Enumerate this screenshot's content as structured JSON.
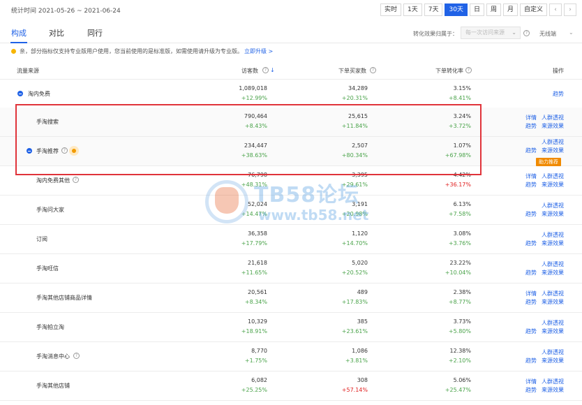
{
  "header": {
    "date_range": "统计时间 2021-05-26 ~ 2021-06-24",
    "range_buttons": [
      "实时",
      "1天",
      "7天",
      "30天",
      "日",
      "周",
      "月",
      "自定义"
    ],
    "active_range": "30天",
    "prev_arrow": "‹",
    "next_arrow": "›"
  },
  "tabs": [
    "构成",
    "对比",
    "同行"
  ],
  "attribution": {
    "label": "转化效果归属于：",
    "placeholder": "每一次访问来源",
    "chevron": "⌄",
    "compare_label": "无线端",
    "compare_chevron": "⌄",
    "help": "?"
  },
  "notice": {
    "text": "亲，部分指标仅支持专业版用户使用，您当前使用的是标准版，如需使用请升级为专业版。",
    "link": "立即升级 >"
  },
  "columns": {
    "source": "流量来源",
    "visitors": "访客数",
    "buyers": "下单买家数",
    "conversion": "下单转化率",
    "ops": "操作",
    "sort_icon": "↓",
    "help": "?"
  },
  "rows": [
    {
      "name": "淘内免费",
      "visitors": "1,089,018",
      "visitors_chg": "+12.99%",
      "buyers": "34,289",
      "buyers_chg": "+20.31%",
      "rate": "3.15%",
      "rate_chg": "+8.41%",
      "ops": [
        "趋势"
      ]
    },
    {
      "name": "手淘搜索",
      "visitors": "790,464",
      "visitors_chg": "+8.43%",
      "buyers": "25,615",
      "buyers_chg": "+11.84%",
      "rate": "3.24%",
      "rate_chg": "+3.72%",
      "ops": [
        "详情",
        "人群透视",
        "趋势",
        "来源效果"
      ]
    },
    {
      "name": "手淘推荐",
      "visitors": "234,447",
      "visitors_chg": "+38.63%",
      "buyers": "2,507",
      "buyers_chg": "+80.34%",
      "rate": "1.07%",
      "rate_chg": "+67.98%",
      "ops": [
        "人群透视",
        "趋势",
        "来源效果"
      ],
      "boost": "助力推荐"
    },
    {
      "name": "淘内免费其他",
      "visitors": "76,798",
      "visitors_chg": "+48.31%",
      "buyers": "3,395",
      "buyers_chg": "+29.61%",
      "rate": "4.42%",
      "rate_chg": "+36.17%",
      "ops": [
        "详情",
        "人群透视",
        "趋势",
        "来源效果"
      ]
    },
    {
      "name": "手淘问大家",
      "visitors": "52,024",
      "visitors_chg": "+14.47%",
      "buyers": "3,191",
      "buyers_chg": "+20.98%",
      "rate": "6.13%",
      "rate_chg": "+7.58%",
      "ops": [
        "人群透视",
        "趋势",
        "来源效果"
      ]
    },
    {
      "name": "订阅",
      "visitors": "36,358",
      "visitors_chg": "+17.79%",
      "buyers": "1,120",
      "buyers_chg": "+14.70%",
      "rate": "3.08%",
      "rate_chg": "+3.76%",
      "ops": [
        "人群透视",
        "趋势",
        "来源效果"
      ]
    },
    {
      "name": "手淘旺信",
      "visitors": "21,618",
      "visitors_chg": "+11.65%",
      "buyers": "5,020",
      "buyers_chg": "+20.52%",
      "rate": "23.22%",
      "rate_chg": "+10.04%",
      "ops": [
        "人群透视",
        "趋势",
        "来源效果"
      ]
    },
    {
      "name": "手淘其他店铺商品详情",
      "visitors": "20,561",
      "visitors_chg": "+8.34%",
      "buyers": "489",
      "buyers_chg": "+17.83%",
      "rate": "2.38%",
      "rate_chg": "+8.77%",
      "ops": [
        "详情",
        "人群透视",
        "趋势",
        "来源效果"
      ]
    },
    {
      "name": "手淘拍立淘",
      "visitors": "10,329",
      "visitors_chg": "+18.91%",
      "buyers": "385",
      "buyers_chg": "+23.61%",
      "rate": "3.73%",
      "rate_chg": "+5.80%",
      "ops": [
        "人群透视",
        "趋势",
        "来源效果"
      ]
    },
    {
      "name": "手淘消息中心",
      "visitors": "8,770",
      "visitors_chg": "+1.75%",
      "buyers": "1,086",
      "buyers_chg": "+3.81%",
      "rate": "12.38%",
      "rate_chg": "+2.10%",
      "ops": [
        "人群透视",
        "趋势",
        "来源效果"
      ]
    },
    {
      "name": "手淘其他店铺",
      "visitors": "6,082",
      "visitors_chg": "+25.25%",
      "buyers": "308",
      "buyers_chg": "+57.14%",
      "rate": "5.06%",
      "rate_chg": "+25.47%",
      "ops": [
        "详情",
        "人群透视",
        "趋势",
        "来源效果"
      ]
    }
  ],
  "watermark": {
    "title": "TB58论坛",
    "url": "www.tb58.net"
  },
  "colors": {
    "accent": "#2062e6",
    "positive": "#4aa34a",
    "negative": "#e02020",
    "highlight": "#e0333a",
    "boost": "#f08a00"
  }
}
